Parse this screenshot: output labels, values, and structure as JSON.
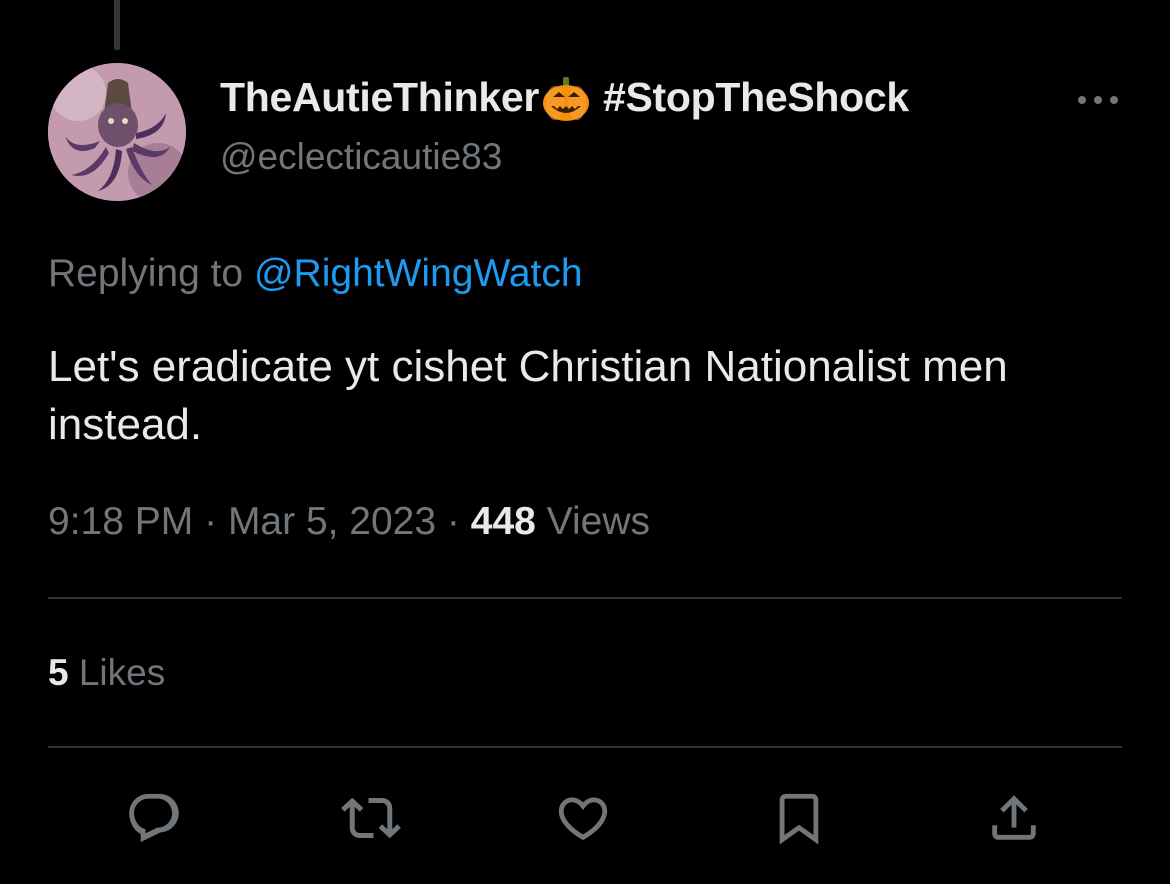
{
  "author": {
    "display_name": "TheAutieThinker",
    "display_name_emoji": "pumpkin-emoji",
    "display_name_suffix": "#StopTheShock",
    "handle": "@eclecticautie83"
  },
  "reply_context": {
    "prefix": "Replying to",
    "mention": "@RightWingWatch"
  },
  "tweet": {
    "text": "Let's eradicate yt cishet Christian Nationalist men instead."
  },
  "meta": {
    "time": "9:18 PM",
    "separator": "·",
    "date": "Mar 5, 2023",
    "views_count": "448",
    "views_label": "Views"
  },
  "engagement": {
    "likes_count": "5",
    "likes_label": "Likes"
  },
  "actions": [
    "reply-icon",
    "retweet-icon",
    "like-icon",
    "bookmark-icon",
    "share-icon"
  ],
  "colors": {
    "background": "#000000",
    "primary_text": "#e7e9ea",
    "secondary_text": "#71767b",
    "link": "#1d9bf0",
    "divider": "#2f3336"
  }
}
